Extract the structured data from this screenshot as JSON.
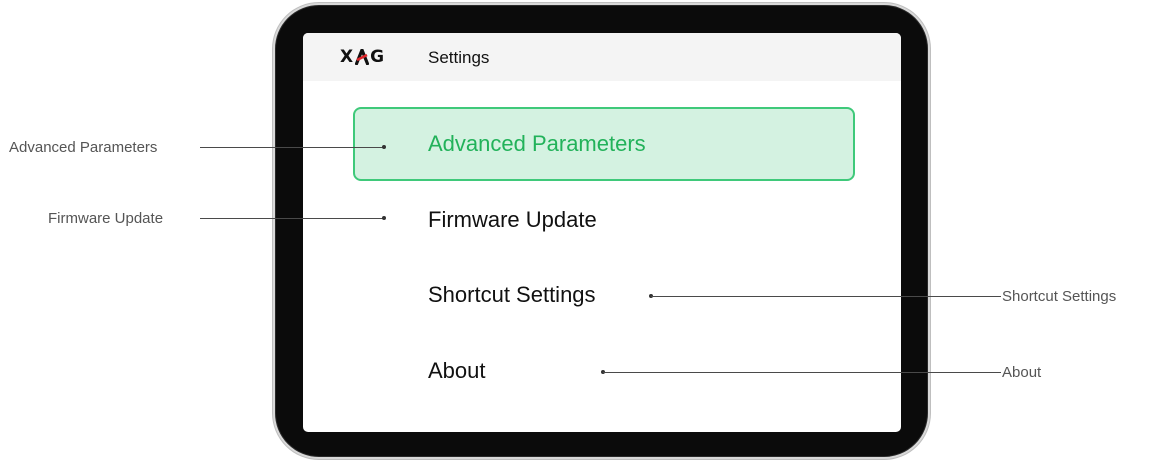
{
  "device": {
    "brand": {
      "logo_text": "XAG",
      "logo_parts": [
        "X",
        "A",
        "G"
      ],
      "logo_accent_color": "#e0262b"
    },
    "title": "Settings"
  },
  "menu": {
    "items": [
      {
        "label": "Advanced Parameters",
        "selected": true
      },
      {
        "label": "Firmware Update",
        "selected": false
      },
      {
        "label": "Shortcut Settings",
        "selected": false
      },
      {
        "label": "About",
        "selected": false
      }
    ],
    "selected_color": "#22b25a",
    "selected_background": "#d4f2e1"
  },
  "annotations": {
    "left": [
      {
        "label": "Advanced Parameters"
      },
      {
        "label": "Firmware Update"
      }
    ],
    "right": [
      {
        "label": "Shortcut Settings"
      },
      {
        "label": "About"
      }
    ]
  }
}
